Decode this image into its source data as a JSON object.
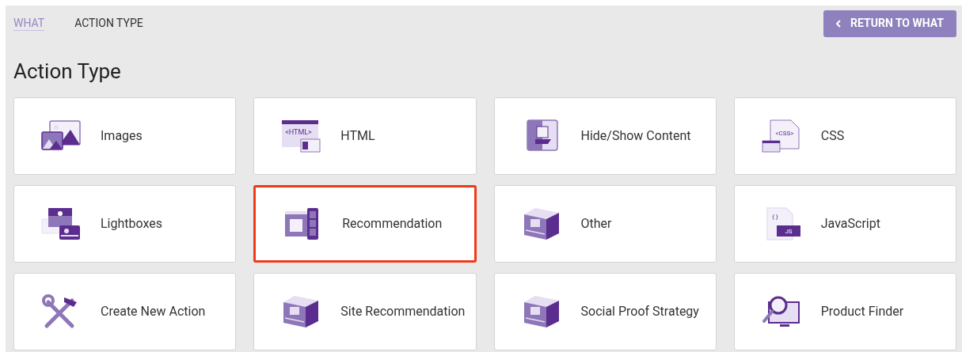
{
  "breadcrumb": [
    {
      "label": "WHAT",
      "kind": "link"
    },
    {
      "label": "ACTION TYPE",
      "kind": "current"
    }
  ],
  "return_button": {
    "label": "RETURN TO WHAT"
  },
  "title": "Action Type",
  "action_types": [
    {
      "label": "Images",
      "kind": "images",
      "selected": false
    },
    {
      "label": "HTML",
      "kind": "html",
      "icon_text": "<HTML>",
      "selected": false
    },
    {
      "label": "Hide/Show Content",
      "kind": "toggle",
      "selected": false
    },
    {
      "label": "CSS",
      "kind": "css",
      "icon_text": "<CSS>",
      "selected": false
    },
    {
      "label": "Lightboxes",
      "kind": "lightbox",
      "selected": false
    },
    {
      "label": "Recommendation",
      "kind": "recommendation",
      "selected": true
    },
    {
      "label": "Other",
      "kind": "box",
      "selected": false
    },
    {
      "label": "JavaScript",
      "kind": "script",
      "icon_text": "{ }",
      "icon_badge": "JS",
      "selected": false
    },
    {
      "label": "Create New Action",
      "kind": "tools",
      "selected": false
    },
    {
      "label": "Site Recommendation",
      "kind": "box",
      "selected": false
    },
    {
      "label": "Social Proof Strategy",
      "kind": "box",
      "selected": false
    },
    {
      "label": "Product Finder",
      "kind": "finder",
      "selected": false
    }
  ]
}
